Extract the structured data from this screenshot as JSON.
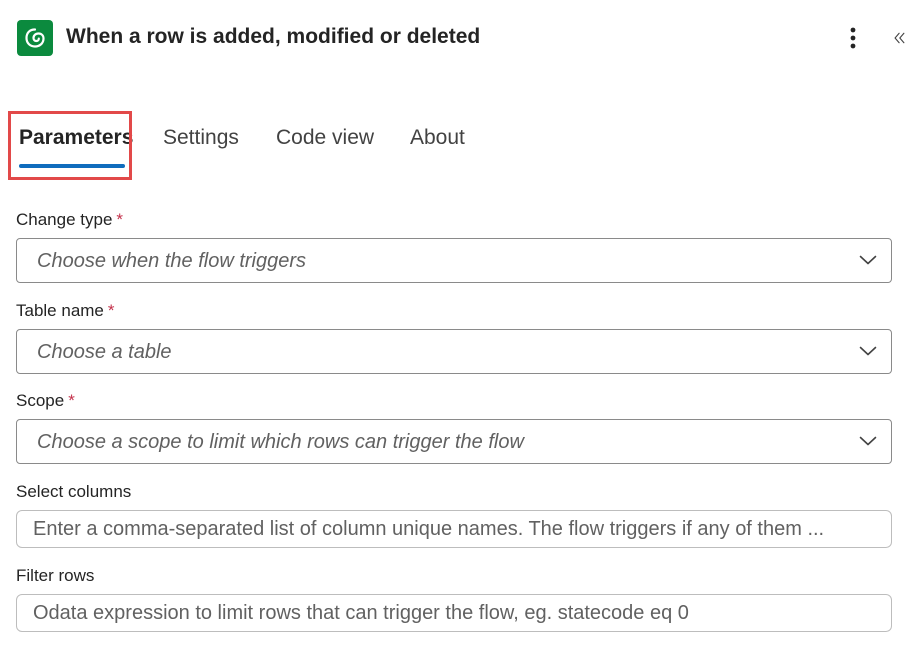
{
  "header": {
    "title": "When a row is added, modified or deleted",
    "app_icon": "dataverse-icon",
    "more_icon": "more-vertical-icon",
    "collapse_icon": "chevron-double-left-icon"
  },
  "tabs": [
    {
      "label": "Parameters",
      "active": true
    },
    {
      "label": "Settings",
      "active": false
    },
    {
      "label": "Code view",
      "active": false
    },
    {
      "label": "About",
      "active": false
    }
  ],
  "fields": {
    "change_type": {
      "label": "Change type",
      "required_mark": "*",
      "placeholder": "Choose when the flow triggers"
    },
    "table_name": {
      "label": "Table name",
      "required_mark": "*",
      "placeholder": "Choose a table"
    },
    "scope": {
      "label": "Scope",
      "required_mark": "*",
      "placeholder": "Choose a scope to limit which rows can trigger the flow"
    },
    "select_columns": {
      "label": "Select columns",
      "placeholder": "Enter a comma-separated list of column unique names. The flow triggers if any of them ..."
    },
    "filter_rows": {
      "label": "Filter rows",
      "placeholder": "Odata expression to limit rows that can trigger the flow, eg. statecode eq 0"
    }
  },
  "colors": {
    "app_icon_bg": "#0b8a3e",
    "tab_accent": "#0f6cbd",
    "highlight": "#e24949",
    "required": "#c4314b"
  }
}
